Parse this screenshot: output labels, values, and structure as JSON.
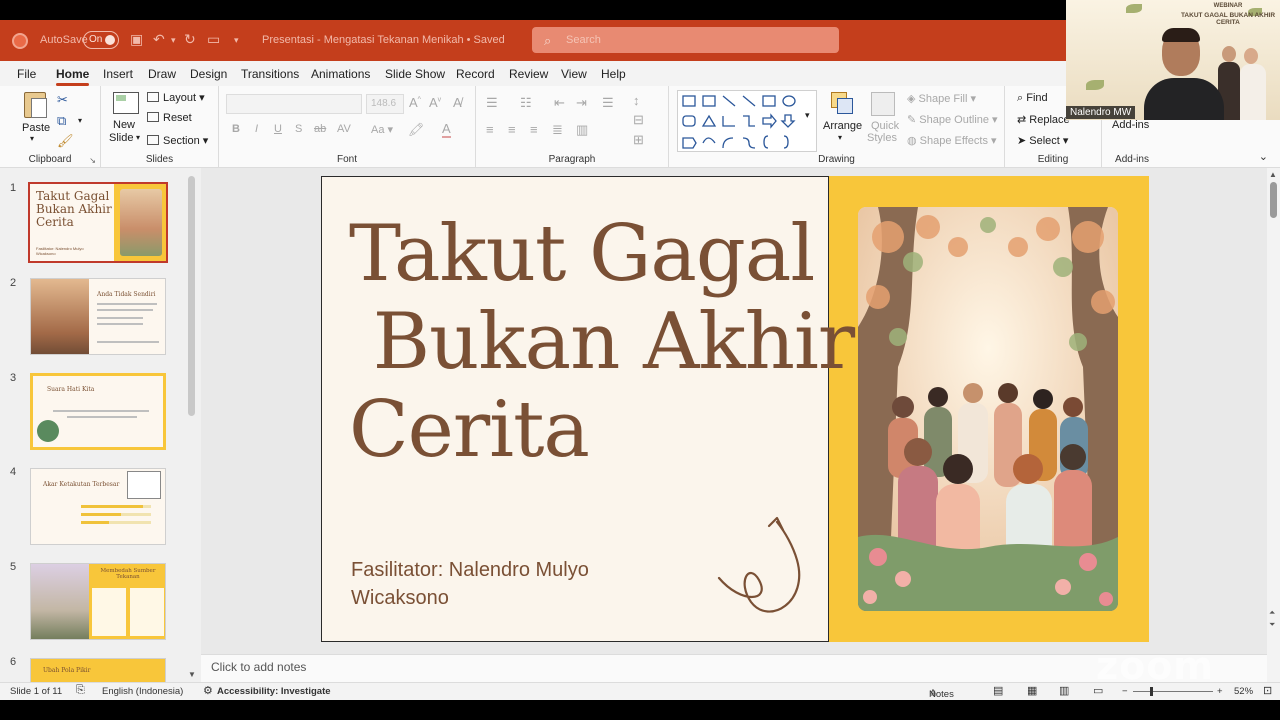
{
  "titlebar": {
    "autosave_label": "AutoSave",
    "autosave_state": "On",
    "doc_title": "Presentasi - Mengatasi Tekanan Menikah • Saved",
    "search_placeholder": "Search"
  },
  "zoom": {
    "participant_name": "Nalendro MW",
    "backdrop_line1": "WEBINAR",
    "backdrop_line2": "TAKUT GAGAL BUKAN AKHIR CERITA",
    "watermark": "zoom"
  },
  "menu": [
    "File",
    "Home",
    "Insert",
    "Draw",
    "Design",
    "Transitions",
    "Animations",
    "Slide Show",
    "Record",
    "Review",
    "View",
    "Help"
  ],
  "ribbon": {
    "clipboard": {
      "paste": "Paste",
      "label": "Clipboard"
    },
    "slides": {
      "new_slide": "New",
      "new_slide2": "Slide",
      "layout": "Layout",
      "reset": "Reset",
      "section": "Section",
      "label": "Slides"
    },
    "font": {
      "size": "148.6",
      "label": "Font"
    },
    "paragraph": {
      "label": "Paragraph"
    },
    "drawing": {
      "arrange": "Arrange",
      "quick_styles1": "Quick",
      "quick_styles2": "Styles",
      "shape_fill": "Shape Fill",
      "shape_outline": "Shape Outline",
      "shape_effects": "Shape Effects",
      "label": "Drawing"
    },
    "editing": {
      "find": "Find",
      "replace": "Replace",
      "select": "Select",
      "label": "Editing"
    },
    "addins": {
      "addins": "Add-ins",
      "label": "Add-ins"
    }
  },
  "thumbnails": [
    {
      "num": "1",
      "title": "Takut Gagal Bukan Akhir Cerita",
      "sub": "Fasilitator: Nalendro Mulyo Wicaksono"
    },
    {
      "num": "2",
      "title": "Anda Tidak Sendiri"
    },
    {
      "num": "3",
      "title": "Suara Hati Kita"
    },
    {
      "num": "4",
      "title": "Akar Ketakutan Terbesar"
    },
    {
      "num": "5",
      "title": "Membedah Sumber Tekanan"
    },
    {
      "num": "6",
      "title": "Ubah Pola Pikir"
    }
  ],
  "slide": {
    "title_l1": "Takut Gagal",
    "title_l2": " Bukan Akhir",
    "title_l3": "Cerita",
    "facilitator_l1": "Fasilitator: Nalendro Mulyo",
    "facilitator_l2": "Wicaksono",
    "accent_color": "#f8c63a",
    "text_color": "#7a5035"
  },
  "notes_placeholder": "Click to add notes",
  "status": {
    "slide_count": "Slide 1 of 11",
    "language": "English (Indonesia)",
    "accessibility": "Accessibility: Investigate",
    "notes": "Notes",
    "zoom": "52%"
  }
}
